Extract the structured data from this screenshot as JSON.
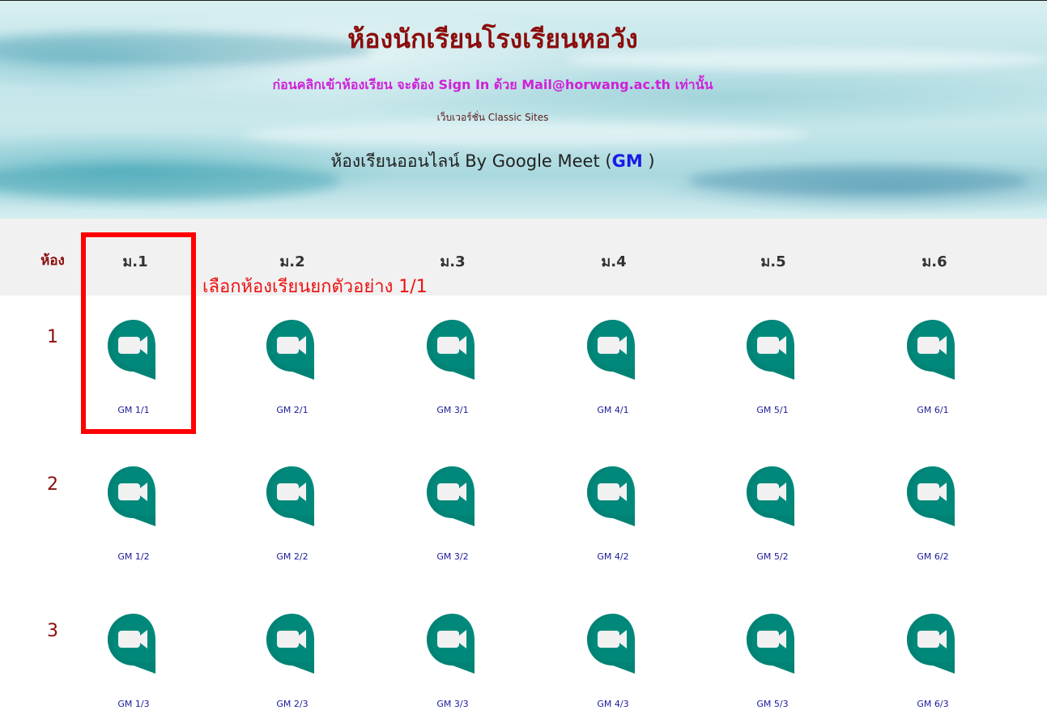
{
  "header": {
    "title": "ห้องนักเรียนโรงเรียนหอวัง",
    "signin_notice": "ก่อนคลิกเข้าห้องเรียน จะต้อง Sign In ด้วย Mail@horwang.ac.th เท่านั้น",
    "server_note": "เว็บเวอร์ชั่น Classic Sites",
    "online_prefix": "ห้องเรียนออนไลน์ By Google Meet (",
    "online_gm": "GM",
    "online_suffix": " )"
  },
  "table": {
    "room_header": "ห้อง",
    "grades": [
      "ม.1",
      "ม.2",
      "ม.3",
      "ม.4",
      "ม.5",
      "ม.6"
    ],
    "rows": [
      {
        "number": "1",
        "links": [
          "GM 1/1",
          "GM 2/1",
          "GM 3/1",
          "GM 4/1",
          "GM 5/1",
          "GM 6/1"
        ]
      },
      {
        "number": "2",
        "links": [
          "GM 1/2",
          "GM 2/2",
          "GM 3/2",
          "GM 4/2",
          "GM 5/2",
          "GM 6/2"
        ]
      },
      {
        "number": "3",
        "links": [
          "GM 1/3",
          "GM 2/3",
          "GM 3/3",
          "GM 4/3",
          "GM 5/3",
          "GM 6/3"
        ]
      }
    ]
  },
  "annotation": {
    "text": "เลือกห้องเรียนยกตัวอย่าง 1/1",
    "color": "#ff0000"
  },
  "icon": {
    "name": "google-meet-icon",
    "color": "#00897b"
  },
  "colors": {
    "title": "#8b0c0c",
    "notice": "#d01fd8",
    "gm_link": "#1a1ae6",
    "label": "#1a1a99",
    "band": "#f1f1f1"
  }
}
